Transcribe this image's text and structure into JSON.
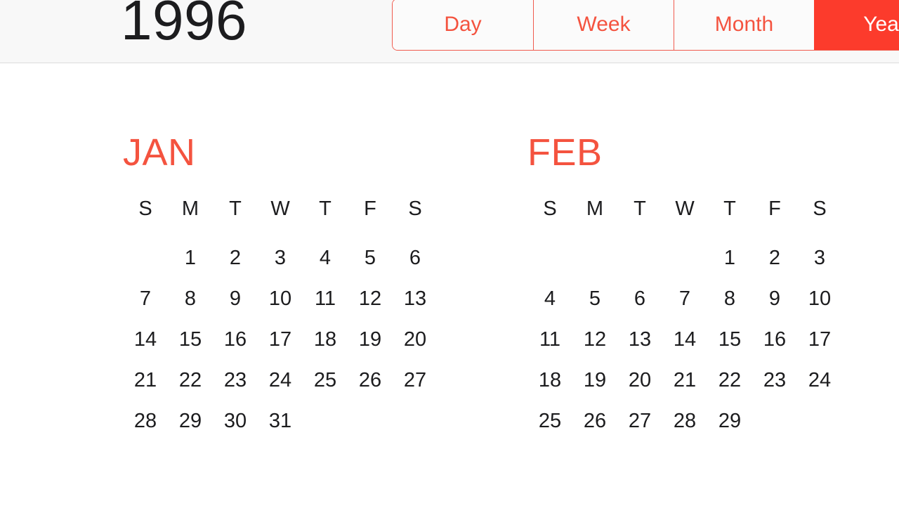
{
  "app": {
    "name": "Calendar",
    "accent_color": "#FC3B2C",
    "accent_color_light": "#F4533F",
    "toolbar_bg": "#F8F8F8",
    "body_bg": "#FFFFFF",
    "text_color": "#1C1C1E"
  },
  "toolbar": {
    "year_title": "1996",
    "view_segments": [
      {
        "label": "Day",
        "selected": false
      },
      {
        "label": "Week",
        "selected": false
      },
      {
        "label": "Month",
        "selected": false
      },
      {
        "label": "Year",
        "selected": true
      }
    ]
  },
  "weekday_headers": [
    "S",
    "M",
    "T",
    "W",
    "T",
    "F",
    "S"
  ],
  "months": [
    {
      "name": "JAN",
      "full_name": "January",
      "lead_blanks": 1,
      "num_days": 31,
      "weeks": [
        [
          "",
          "1",
          "2",
          "3",
          "4",
          "5",
          "6"
        ],
        [
          "7",
          "8",
          "9",
          "10",
          "11",
          "12",
          "13"
        ],
        [
          "14",
          "15",
          "16",
          "17",
          "18",
          "19",
          "20"
        ],
        [
          "21",
          "22",
          "23",
          "24",
          "25",
          "26",
          "27"
        ],
        [
          "28",
          "29",
          "30",
          "31",
          "",
          "",
          ""
        ]
      ]
    },
    {
      "name": "FEB",
      "full_name": "February",
      "lead_blanks": 4,
      "num_days": 29,
      "weeks": [
        [
          "",
          "",
          "",
          "",
          "1",
          "2",
          "3"
        ],
        [
          "4",
          "5",
          "6",
          "7",
          "8",
          "9",
          "10"
        ],
        [
          "11",
          "12",
          "13",
          "14",
          "15",
          "16",
          "17"
        ],
        [
          "18",
          "19",
          "20",
          "21",
          "22",
          "23",
          "24"
        ],
        [
          "25",
          "26",
          "27",
          "28",
          "29",
          "",
          ""
        ]
      ]
    }
  ]
}
